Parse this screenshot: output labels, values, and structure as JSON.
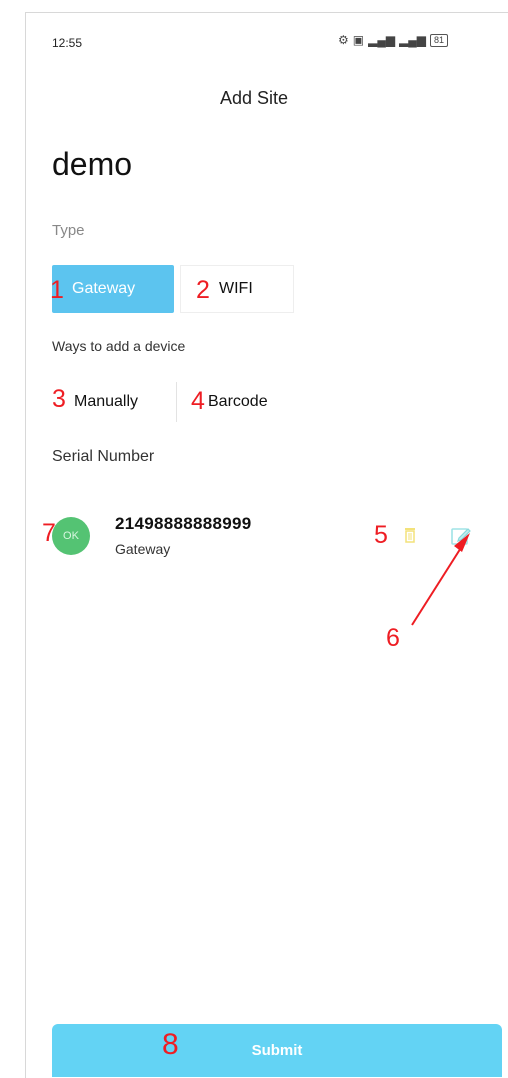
{
  "status": {
    "time": "12:55",
    "icons": [
      "alarm-icon",
      "nfc-icon",
      "signal-icon",
      "signal-icon",
      "battery-icon"
    ],
    "battery": "81"
  },
  "header": {
    "title": "Add Site"
  },
  "site": {
    "name": "demo"
  },
  "type": {
    "label": "Type",
    "options": [
      {
        "label": "Gateway",
        "selected": true
      },
      {
        "label": "WIFI",
        "selected": false
      }
    ]
  },
  "ways": {
    "label": "Ways to add a device",
    "options": [
      {
        "label": "Manually"
      },
      {
        "label": "Barcode"
      }
    ]
  },
  "serial": {
    "label": "Serial Number"
  },
  "device": {
    "avatar": "OK",
    "serial": "21498888888999",
    "type": "Gateway"
  },
  "submit": {
    "label": "Submit"
  },
  "annotations": [
    "1",
    "2",
    "3",
    "4",
    "5",
    "6",
    "7",
    "8"
  ],
  "colors": {
    "accent": "#5cc4ef",
    "submit": "#63d3f4",
    "ok": "#54c373",
    "annotation": "#ee1d23"
  }
}
